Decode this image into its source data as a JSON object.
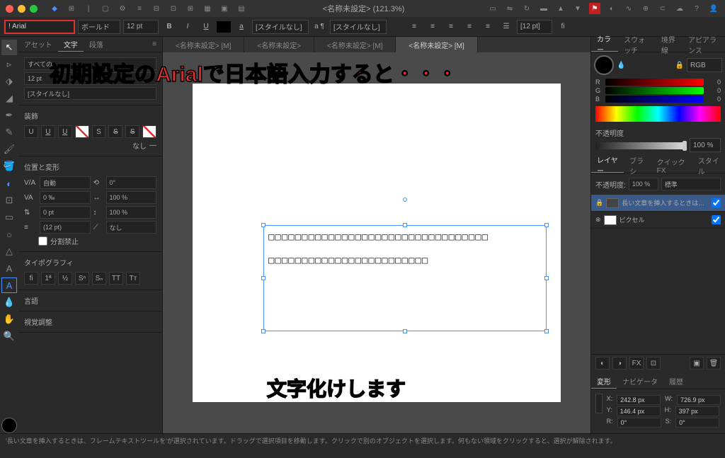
{
  "titlebar": {
    "doc_title": "<名称未設定> (121.3%)"
  },
  "context": {
    "font": "! Arial",
    "weight": "ボールド",
    "size": "12 pt",
    "char_style": "[スタイルなし]",
    "para_style": "[スタイルなし]",
    "leading": "[12 pt]"
  },
  "left_tabs": {
    "asset": "アセット",
    "text": "文字",
    "para": "段落"
  },
  "text_panel": {
    "all": "すべての…",
    "size": "12 pt",
    "style": "[スタイルなし]",
    "decoration_title": "装飾",
    "decoration_none": "なし",
    "position_title": "位置と変形",
    "va_auto": "自動",
    "va_permil": "0 ‰",
    "baseline": "0 pt",
    "leading": "(12 pt)",
    "split": "分割禁止",
    "rotation": "0°",
    "hscale": "100 %",
    "vscale": "100 %",
    "shear": "なし",
    "typo_title": "タイポグラフィ",
    "lang_title": "言語",
    "optical_title": "視覚調整"
  },
  "doc_tabs": [
    "<名称未設定> [M]",
    "<名称未設定>",
    "<名称未設定> [M]",
    "<名称未設定> [M]"
  ],
  "overlay": {
    "line1": "初期設定のArialで日本語入力すると・・・",
    "line2": "文字化けします"
  },
  "tofu": {
    "block1": "□□□□□□□□□□□□□□□□□□□□□□□□□□□□□□□□□",
    "block2": "□□□□□□□□□□□□□□□□□□□□□□□□"
  },
  "right_tabs": {
    "color": "カラー",
    "swatch": "スウォッチ",
    "stroke": "境界線",
    "appearance": "アピアランス"
  },
  "color_panel": {
    "mode": "RGB",
    "r": "0",
    "g": "0",
    "b": "0",
    "opacity_label": "不透明度",
    "opacity_value": "100 %"
  },
  "layer_tabs": {
    "layer": "レイヤー",
    "brush": "ブラシ",
    "quickfx": "クイック FX",
    "style": "スタイル"
  },
  "layers": {
    "opacity_label": "不透明度:",
    "opacity": "100 %",
    "blend": "標準",
    "item1": "長い文章を挿入するときは、フレー……",
    "item2": "ピクセル"
  },
  "transform_tabs": {
    "transform": "変形",
    "navigator": "ナビゲータ",
    "history": "履歴"
  },
  "transform": {
    "x_label": "X:",
    "x": "242.8 px",
    "y_label": "Y:",
    "y": "146.4 px",
    "w_label": "W:",
    "w": "726.9 px",
    "h_label": "H:",
    "h": "397 px",
    "r_label": "R:",
    "r": "0°",
    "s_label": "S:",
    "s": "0°"
  },
  "statusbar": "'長い文章を挿入するときは、フレームテキストツールを'が選択されています。ドラッグで選択項目を移動します。クリックで別のオブジェクトを選択します。何もない領域をクリックすると、選択が解除されます。"
}
